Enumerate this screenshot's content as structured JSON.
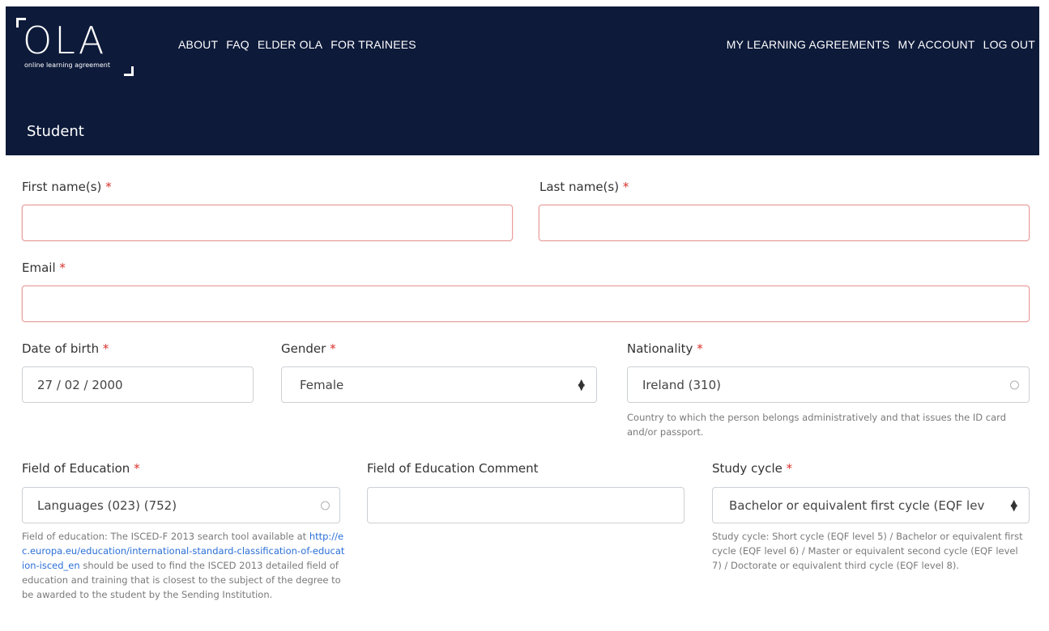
{
  "logo": {
    "text": "OLA",
    "subtitle": "online learning agreement"
  },
  "nav": {
    "left": [
      "ABOUT",
      "FAQ",
      "ELDER OLA",
      "FOR TRAINEES"
    ],
    "right": [
      "MY LEARNING AGREEMENTS",
      "MY ACCOUNT",
      "LOG OUT"
    ]
  },
  "section": {
    "title": "Student"
  },
  "required_mark": "*",
  "form": {
    "first_name": {
      "label": "First name(s)",
      "value": ""
    },
    "last_name": {
      "label": "Last name(s)",
      "value": ""
    },
    "email": {
      "label": "Email",
      "value": ""
    },
    "dob": {
      "label": "Date of birth",
      "value": "27 / 02 / 2000"
    },
    "gender": {
      "label": "Gender",
      "value": "Female"
    },
    "nationality": {
      "label": "Nationality",
      "value": "Ireland (310)",
      "help": "Country to which the person belongs administratively and that issues the ID card and/or passport."
    },
    "field_of_education": {
      "label": "Field of Education",
      "value": "Languages (023) (752)",
      "help_before": "Field of education: The ISCED-F 2013 search tool available at ",
      "help_link": "http://ec.europa.eu/education/international-standard-classification-of-education-isced_en",
      "help_after": " should be used to find the ISCED 2013 detailed field of education and training that is closest to the subject of the degree to be awarded to the student by the Sending Institution."
    },
    "foe_comment": {
      "label": "Field of Education Comment",
      "value": ""
    },
    "study_cycle": {
      "label": "Study cycle",
      "value": "Bachelor or equivalent first cycle (EQF lev",
      "help": "Study cycle: Short cycle (EQF level 5) / Bachelor or equivalent first cycle (EQF level 6) / Master or equivalent second cycle (EQF level 7) / Doctorate or equivalent third cycle (EQF level 8)."
    }
  },
  "colors": {
    "navbar": "#0d1a3a",
    "required": "#d9302b",
    "link": "#2a6fd6",
    "error_border": "#e8a0a0"
  }
}
